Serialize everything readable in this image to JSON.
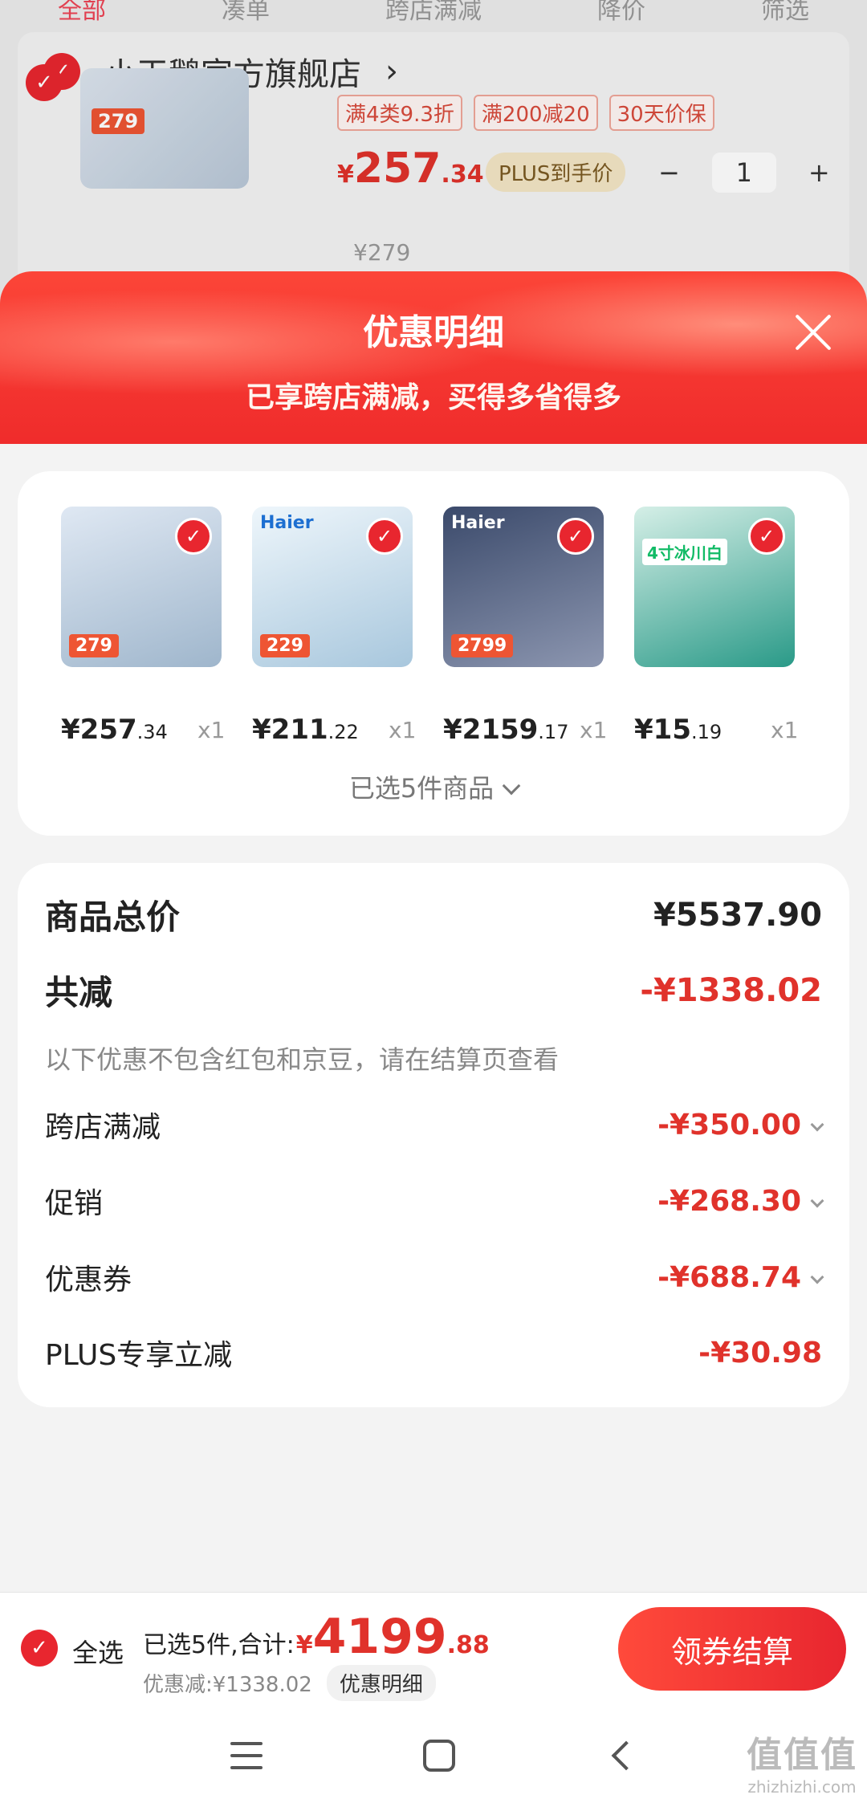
{
  "background": {
    "tabs": [
      "全部",
      "凑单",
      "跨店满减",
      "降价",
      "筛选"
    ],
    "store_name": "小天鹅官方旗舰店",
    "store_chevron": "›",
    "thumb_price": "279",
    "tags": [
      "满4类9.3折",
      "满200减20",
      "30天价保"
    ],
    "price_currency": "¥",
    "price_int": "257",
    "price_dec": ".34",
    "plus_label": "PLUS到手价",
    "qty_minus": "−",
    "qty_value": "1",
    "qty_plus": "+",
    "old_price": "¥279"
  },
  "modal": {
    "title": "优惠明细",
    "subtitle": "已享跨店满减，买得多省得多"
  },
  "products": [
    {
      "brand": "",
      "tag": "279",
      "price_int": "¥257",
      "price_dec": ".34",
      "qty": "x1"
    },
    {
      "brand": "Haier",
      "tag": "229",
      "price_int": "¥211",
      "price_dec": ".22",
      "qty": "x1"
    },
    {
      "brand": "Haier",
      "tag": "2799",
      "price_int": "¥2159",
      "price_dec": ".17",
      "qty": "x1"
    },
    {
      "brand": "",
      "tag": "4寸冰川白",
      "price_int": "¥15",
      "price_dec": ".19",
      "qty": "x1"
    }
  ],
  "selected_text": "已选5件商品",
  "detail": {
    "total_label": "商品总价",
    "total_value": "¥5537.90",
    "reduce_label": "共减",
    "reduce_value": "-¥1338.02",
    "note": "以下优惠不包含红包和京豆，请在结算页查看",
    "items": [
      {
        "label": "跨店满减",
        "value": "-¥350.00"
      },
      {
        "label": "促销",
        "value": "-¥268.30"
      },
      {
        "label": "优惠券",
        "value": "-¥688.74"
      },
      {
        "label": "PLUS专享立减",
        "value": "-¥30.98"
      }
    ]
  },
  "bottom": {
    "select_all": "全选",
    "summary_prefix": "已选5件,合计:",
    "currency": "¥",
    "total_int": "4199",
    "total_dec": ".88",
    "discount_text": "优惠减:¥1338.02",
    "detail_btn": "优惠明细",
    "checkout_btn": "领券结算"
  },
  "watermark": {
    "line1": "值值值",
    "line2": "zhizhizhi.com"
  },
  "colors": {
    "accent": "#e8262f",
    "price_red": "#e0322b"
  }
}
